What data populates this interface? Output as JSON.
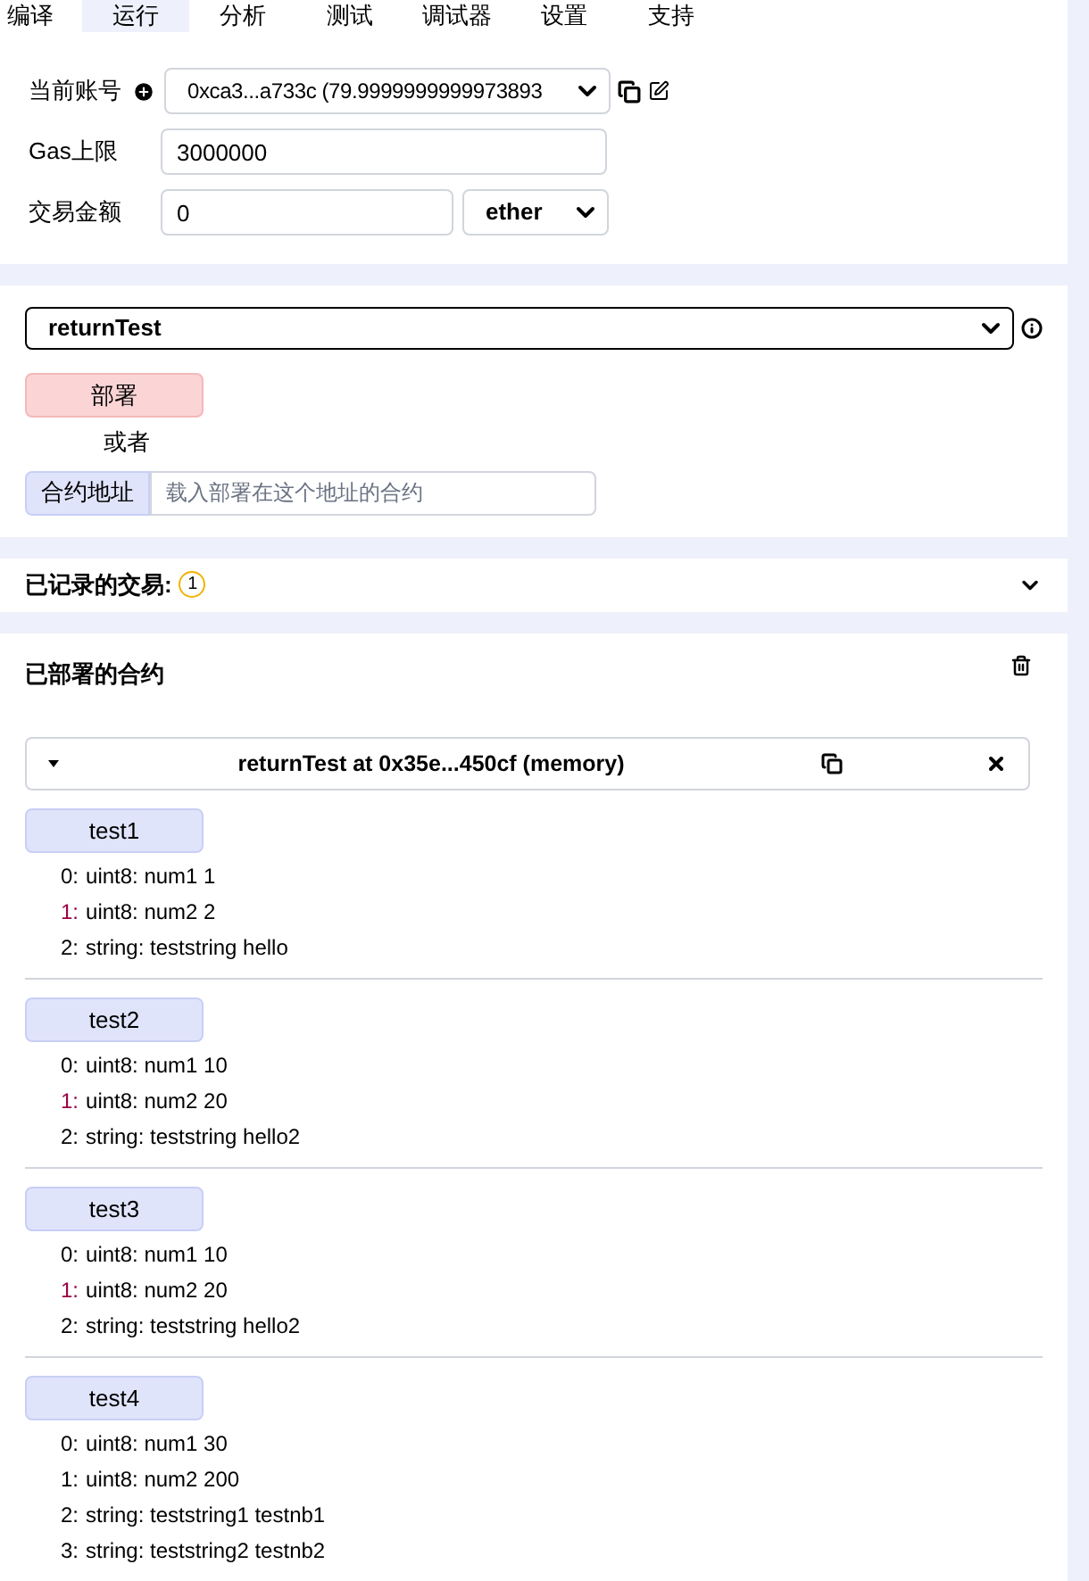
{
  "tabs": [
    {
      "label": "编译",
      "selected": false
    },
    {
      "label": "运行",
      "selected": true
    },
    {
      "label": "分析",
      "selected": false
    },
    {
      "label": "测试",
      "selected": false
    },
    {
      "label": "调试器",
      "selected": false
    },
    {
      "label": "设置",
      "selected": false
    },
    {
      "label": "支持",
      "selected": false
    }
  ],
  "account": {
    "label": "当前账号",
    "value": "0xca3...a733c (79.9999999999973893"
  },
  "gas": {
    "label": "Gas上限",
    "value": "3000000"
  },
  "value": {
    "label": "交易金额",
    "amount": "0",
    "unit": "ether"
  },
  "contract_select": {
    "value": "returnTest"
  },
  "deploy": {
    "button": "部署",
    "or": "或者",
    "address_button": "合约地址",
    "address_placeholder": "载入部署在这个地址的合约"
  },
  "recorded": {
    "title": "已记录的交易:",
    "count": "1",
    "expanded": false
  },
  "deployed": {
    "title": "已部署的合约",
    "instance": {
      "title": "returnTest at 0x35e...450cf (memory)",
      "expanded": true,
      "functions": [
        {
          "name": "test1",
          "outputs": [
            {
              "index": "0:",
              "text": "uint8: num1 1",
              "highlighted": false
            },
            {
              "index": "1:",
              "text": "uint8: num2 2",
              "highlighted": true
            },
            {
              "index": "2:",
              "text": "string: teststring hello",
              "highlighted": false
            }
          ]
        },
        {
          "name": "test2",
          "outputs": [
            {
              "index": "0:",
              "text": "uint8: num1 10",
              "highlighted": false
            },
            {
              "index": "1:",
              "text": "uint8: num2 20",
              "highlighted": true
            },
            {
              "index": "2:",
              "text": "string: teststring hello2",
              "highlighted": false
            }
          ]
        },
        {
          "name": "test3",
          "outputs": [
            {
              "index": "0:",
              "text": "uint8: num1 10",
              "highlighted": false
            },
            {
              "index": "1:",
              "text": "uint8: num2 20",
              "highlighted": true
            },
            {
              "index": "2:",
              "text": "string: teststring hello2",
              "highlighted": false
            }
          ]
        },
        {
          "name": "test4",
          "outputs": [
            {
              "index": "0:",
              "text": "uint8: num1 30",
              "highlighted": false
            },
            {
              "index": "1:",
              "text": "uint8: num2 200",
              "highlighted": false
            },
            {
              "index": "2:",
              "text": "string: teststring1 testnb1",
              "highlighted": false
            },
            {
              "index": "3:",
              "text": "string: teststring2 testnb2",
              "highlighted": false
            }
          ]
        }
      ]
    }
  }
}
